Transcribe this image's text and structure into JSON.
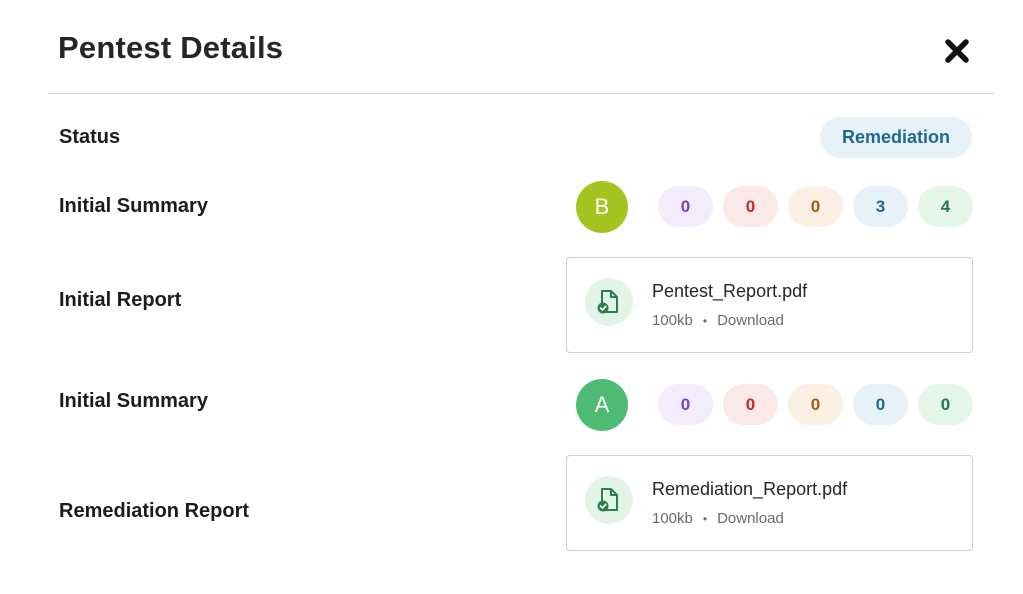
{
  "header": {
    "title": "Pentest Details"
  },
  "status": {
    "label": "Status",
    "value": "Remediation"
  },
  "initial_summary": {
    "label": "Initial Summary",
    "grade": "B",
    "grade_color": "#a6c41f",
    "counts": [
      "0",
      "0",
      "0",
      "3",
      "4"
    ]
  },
  "initial_report": {
    "label": "Initial Report",
    "file_name": "Pentest_Report.pdf",
    "file_size": "100kb",
    "action": "Download"
  },
  "second_summary": {
    "label": "Initial Summary",
    "grade": "A",
    "grade_color": "#4dbb74",
    "counts": [
      "0",
      "0",
      "0",
      "0",
      "0"
    ]
  },
  "remediation_report": {
    "label": "Remediation Report",
    "file_name": "Remediation_Report.pdf",
    "file_size": "100kb",
    "action": "Download"
  },
  "icons": {
    "close": "close-icon",
    "file": "file-check-icon"
  }
}
